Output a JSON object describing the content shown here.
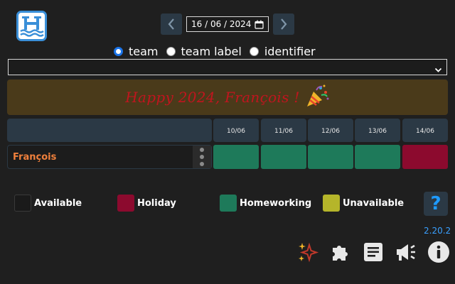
{
  "app": {
    "logo_icon": "h-waves-logo-icon",
    "version": "2.20.2"
  },
  "date_picker": {
    "value": "16 / 06 / 2024",
    "prev_icon": "chevron-left-icon",
    "next_icon": "chevron-right-icon",
    "calendar_icon": "calendar-icon"
  },
  "search_mode": {
    "options": [
      {
        "label": "team",
        "checked": true
      },
      {
        "label": "team label",
        "checked": false
      },
      {
        "label": "identifier",
        "checked": false
      }
    ]
  },
  "team_select": {
    "value": ""
  },
  "banner": {
    "text": "Happy 2024, François !",
    "emoji_icon": "party-popper-icon"
  },
  "calendar": {
    "days": [
      "10/06",
      "11/06",
      "12/06",
      "13/06",
      "14/06"
    ],
    "members": [
      {
        "name": "François",
        "statuses": [
          "Homeworking",
          "Homeworking",
          "Homeworking",
          "Homeworking",
          "Holiday"
        ]
      }
    ]
  },
  "legend": [
    {
      "label": "Available",
      "color": "#1a1a1a"
    },
    {
      "label": "Holiday",
      "color": "#8c0a2e"
    },
    {
      "label": "Homeworking",
      "color": "#1e7a5a"
    },
    {
      "label": "Unavailable",
      "color": "#b5b52a"
    }
  ],
  "help_label": "?",
  "toolbar": {
    "icons": [
      "sparkles-icon",
      "puzzle-icon",
      "document-icon",
      "megaphone-icon",
      "info-icon"
    ]
  }
}
